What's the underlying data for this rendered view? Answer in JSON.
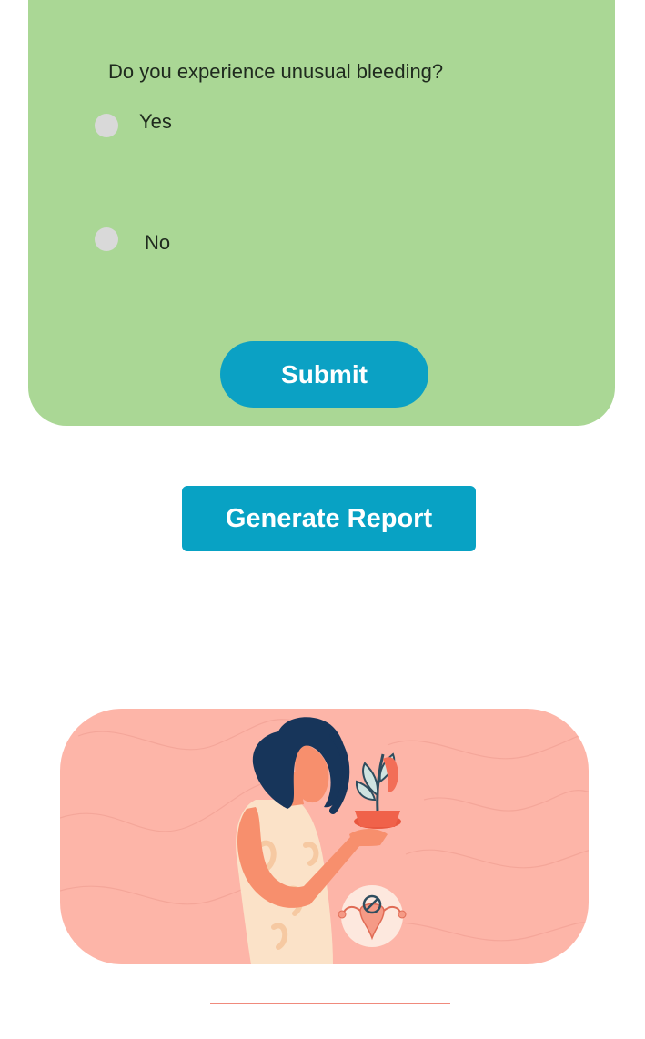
{
  "question": {
    "text": "Do you experience unusual bleeding?",
    "options": [
      {
        "label": "Yes",
        "selected": false
      },
      {
        "label": "No",
        "selected": false
      }
    ]
  },
  "buttons": {
    "submit_label": "Submit",
    "generate_label": "Generate Report"
  },
  "colors": {
    "card_bg": "#aad795",
    "button_bg": "#0ba1c4",
    "radio": "#d9d9d9",
    "banner_bg": "#fdb5a8",
    "accent_line": "#f08a7c"
  },
  "illustration": {
    "description_icon": "woman-holding-wilting-plant-illustration",
    "badge_icon": "uterus-prohibited-icon"
  }
}
